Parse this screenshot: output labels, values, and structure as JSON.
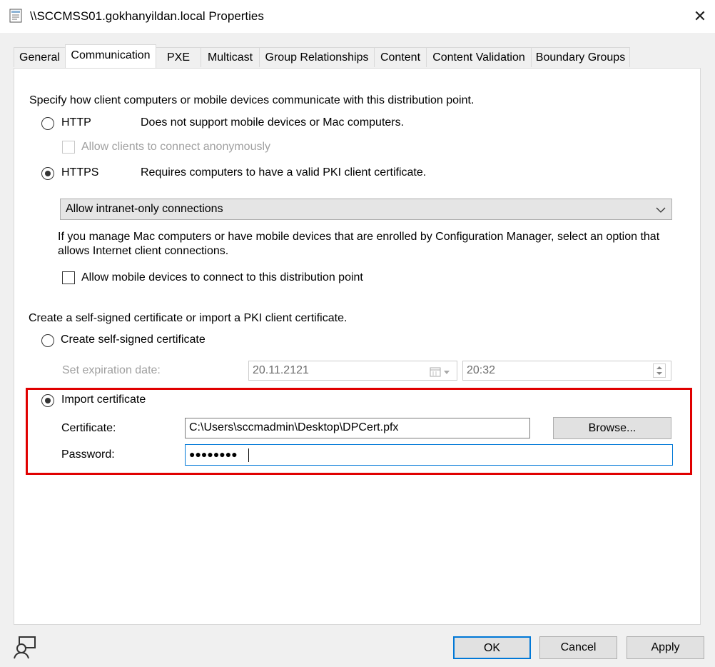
{
  "window": {
    "title": "\\\\SCCMSS01.gokhanyildan.local Properties",
    "close_glyph": "✕"
  },
  "tabs": [
    "General",
    "Communication",
    "PXE",
    "Multicast",
    "Group Relationships",
    "Content",
    "Content Validation",
    "Boundary Groups"
  ],
  "active_tab": "Communication",
  "communication": {
    "intro": "Specify how client computers or mobile devices communicate with this distribution point.",
    "http_label": "HTTP",
    "http_desc": "Does not support mobile devices or Mac computers.",
    "anon_label": "Allow clients to connect anonymously",
    "https_label": "HTTPS",
    "https_desc": "Requires computers to have a valid PKI client certificate.",
    "connection_select": "Allow intranet-only connections",
    "mac_note_line1": "If you manage Mac computers or have mobile devices that are enrolled by Configuration Manager, select an option that",
    "mac_note_line2": "allows Internet client connections.",
    "mobile_label": "Allow mobile devices to connect to this distribution point",
    "cert_intro": "Create a self-signed certificate or import a PKI client certificate.",
    "self_signed_label": "Create self-signed certificate",
    "expiration_label": "Set expiration date:",
    "expiration_date": "20.11.2121",
    "expiration_time": "20:32",
    "import_label": "Import certificate",
    "certificate_label": "Certificate:",
    "certificate_path": "C:\\Users\\sccmadmin\\Desktop\\DPCert.pfx",
    "browse_label": "Browse...",
    "password_label": "Password:",
    "password_masked": "●●●●●●●●",
    "selected_protocol": "HTTPS",
    "selected_certificate_option": "Import certificate"
  },
  "footer": {
    "ok": "OK",
    "cancel": "Cancel",
    "apply": "Apply"
  },
  "colors": {
    "highlight_border": "#e00000",
    "focus_border": "#0078d7"
  }
}
